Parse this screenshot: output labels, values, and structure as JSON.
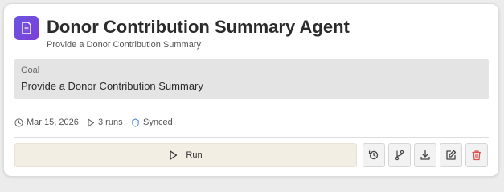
{
  "agent": {
    "title": "Donor Contribution Summary Agent",
    "subtitle": "Provide a Donor Contribution Summary",
    "icon": "document-icon",
    "accent_color": "#6a55e0"
  },
  "goal": {
    "label": "Goal",
    "text": "Provide a Donor Contribution Summary"
  },
  "meta": {
    "date": "Mar 15, 2026",
    "runs": "3 runs",
    "sync_status": "Synced",
    "sync_color": "#4a7fd6"
  },
  "actions": {
    "run_label": "Run",
    "buttons": [
      {
        "name": "history",
        "icon": "history-icon"
      },
      {
        "name": "branch",
        "icon": "branch-icon"
      },
      {
        "name": "download",
        "icon": "download-icon"
      },
      {
        "name": "edit",
        "icon": "edit-icon"
      },
      {
        "name": "delete",
        "icon": "trash-icon",
        "color": "#d9534f"
      }
    ]
  }
}
